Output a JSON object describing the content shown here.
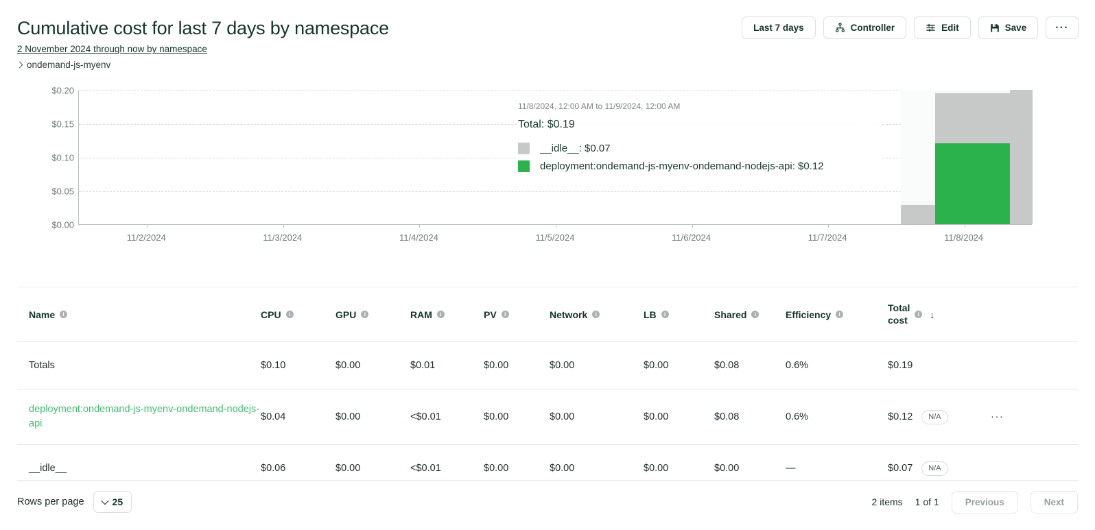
{
  "header": {
    "title": "Cumulative cost for last 7 days by namespace",
    "subtitle_link": "2 November 2024 through now by namespace",
    "breadcrumb": "ondemand-js-myenv",
    "buttons": {
      "date_range": "Last 7 days",
      "controller": "Controller",
      "edit": "Edit",
      "save": "Save",
      "more": "···"
    }
  },
  "chart_data": {
    "type": "bar",
    "title": "Cumulative cost for last 7 days by namespace",
    "xlabel": "",
    "ylabel": "",
    "ylim": [
      0,
      0.2
    ],
    "ytick_labels": [
      "$0.00",
      "$0.05",
      "$0.10",
      "$0.15",
      "$0.20"
    ],
    "ytick_values": [
      0,
      0.05,
      0.1,
      0.15,
      0.2
    ],
    "xtick_labels": [
      "11/2/2024",
      "11/3/2024",
      "11/4/2024",
      "11/5/2024",
      "11/6/2024",
      "11/7/2024",
      "11/8/2024"
    ],
    "grid": true,
    "legend_position": "tooltip",
    "stacked": true,
    "series": [
      {
        "name": "deployment:ondemand-js-myenv-ondemand-nodejs-api",
        "color": "#2BB24C",
        "values": [
          0,
          0,
          0,
          0,
          0,
          0,
          0.12
        ]
      },
      {
        "name": "__idle__",
        "color": "#C7C9C8",
        "values": [
          0,
          0,
          0,
          0,
          0,
          0,
          0.07
        ]
      }
    ],
    "bars": [
      {
        "x_frac": 0.862,
        "width_frac": 0.036,
        "green": 0.0,
        "gray": 0.035
      },
      {
        "x_frac": 0.898,
        "width_frac": 0.078,
        "green": 0.12,
        "gray": 0.075
      },
      {
        "x_frac": 0.976,
        "width_frac": 0.024,
        "green": 0.0,
        "gray": 0.2
      }
    ],
    "tooltip": {
      "range": "11/8/2024, 12:00 AM to 11/9/2024, 12:00 AM",
      "total_label": "Total: $0.19",
      "items": [
        {
          "swatch": "#C7C9C8",
          "text": "__idle__: $0.07"
        },
        {
          "swatch": "#2BB24C",
          "text": "deployment:ondemand-js-myenv-ondemand-nodejs-api: $0.12"
        }
      ]
    }
  },
  "table": {
    "columns": [
      {
        "key": "name",
        "label": "Name",
        "info": true,
        "sorted": false
      },
      {
        "key": "cpu",
        "label": "CPU",
        "info": true,
        "sorted": false
      },
      {
        "key": "gpu",
        "label": "GPU",
        "info": true,
        "sorted": false
      },
      {
        "key": "ram",
        "label": "RAM",
        "info": true,
        "sorted": false
      },
      {
        "key": "pv",
        "label": "PV",
        "info": true,
        "sorted": false
      },
      {
        "key": "network",
        "label": "Network",
        "info": true,
        "sorted": false
      },
      {
        "key": "lb",
        "label": "LB",
        "info": true,
        "sorted": false
      },
      {
        "key": "shared",
        "label": "Shared",
        "info": true,
        "sorted": false
      },
      {
        "key": "efficiency",
        "label": "Efficiency",
        "info": true,
        "sorted": false
      },
      {
        "key": "total_cost",
        "label_line1": "Total",
        "label_line2": "cost",
        "info": true,
        "sorted": true,
        "sort_dir": "↓"
      }
    ],
    "rows": [
      {
        "name": "Totals",
        "is_link": false,
        "cpu": "$0.10",
        "gpu": "$0.00",
        "ram": "$0.01",
        "pv": "$0.00",
        "network": "$0.00",
        "lb": "$0.00",
        "shared": "$0.08",
        "efficiency": "0.6%",
        "total_cost": "$0.19",
        "badge": "",
        "menu": ""
      },
      {
        "name": "deployment:ondemand-js-myenv-ondemand-nodejs-api",
        "is_link": true,
        "cpu": "$0.04",
        "gpu": "$0.00",
        "ram": "<$0.01",
        "pv": "$0.00",
        "network": "$0.00",
        "lb": "$0.00",
        "shared": "$0.08",
        "efficiency": "0.6%",
        "total_cost": "$0.12",
        "badge": "N/A",
        "menu": "···"
      },
      {
        "name": "__idle__",
        "is_link": false,
        "cpu": "$0.06",
        "gpu": "$0.00",
        "ram": "<$0.01",
        "pv": "$0.00",
        "network": "$0.00",
        "lb": "$0.00",
        "shared": "$0.00",
        "efficiency": "—",
        "total_cost": "$0.07",
        "badge": "N/A",
        "menu": ""
      }
    ]
  },
  "footer": {
    "rows_per_page_label": "Rows per page",
    "rows_per_page_value": "25",
    "item_count": "2 items",
    "page_indicator": "1 of 1",
    "previous": "Previous",
    "next": "Next"
  },
  "colors": {
    "brand_green": "#2BB24C",
    "link_green": "#42bd6f",
    "idle_gray": "#C7C9C8",
    "text_dark": "#14342a"
  }
}
